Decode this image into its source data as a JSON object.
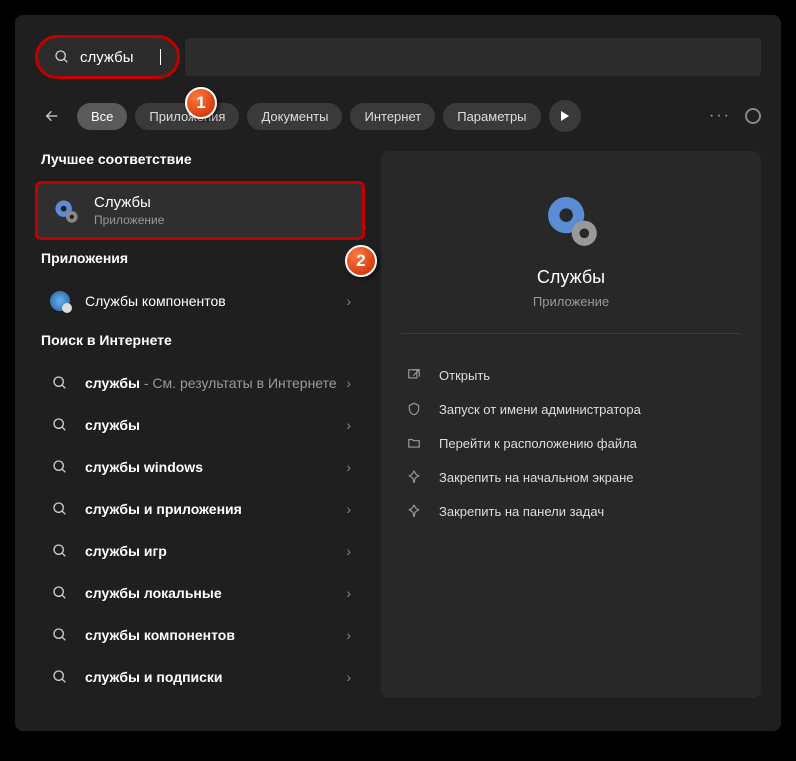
{
  "search": {
    "value": "службы"
  },
  "filters": {
    "all": "Все",
    "apps": "Приложения",
    "docs": "Документы",
    "internet": "Интернет",
    "settings": "Параметры"
  },
  "sections": {
    "best_match": "Лучшее соответствие",
    "apps": "Приложения",
    "web": "Поиск в Интернете"
  },
  "best": {
    "title": "Службы",
    "sub": "Приложение"
  },
  "app_results": [
    {
      "label": "Службы компонентов"
    }
  ],
  "web_results": [
    {
      "label": "службы",
      "suffix": " - См. результаты в Интернете"
    },
    {
      "label": "службы"
    },
    {
      "label": "службы windows"
    },
    {
      "label": "службы и приложения"
    },
    {
      "label": "службы игр"
    },
    {
      "label": "службы локальные"
    },
    {
      "label": "службы компонентов"
    },
    {
      "label": "службы и подписки"
    }
  ],
  "preview": {
    "title": "Службы",
    "sub": "Приложение"
  },
  "actions": [
    {
      "label": "Открыть",
      "icon": "open"
    },
    {
      "label": "Запуск от имени администратора",
      "icon": "admin"
    },
    {
      "label": "Перейти к расположению файла",
      "icon": "folder"
    },
    {
      "label": "Закрепить на начальном экране",
      "icon": "pin"
    },
    {
      "label": "Закрепить на панели задач",
      "icon": "pin"
    }
  ],
  "badges": {
    "one": "1",
    "two": "2"
  }
}
